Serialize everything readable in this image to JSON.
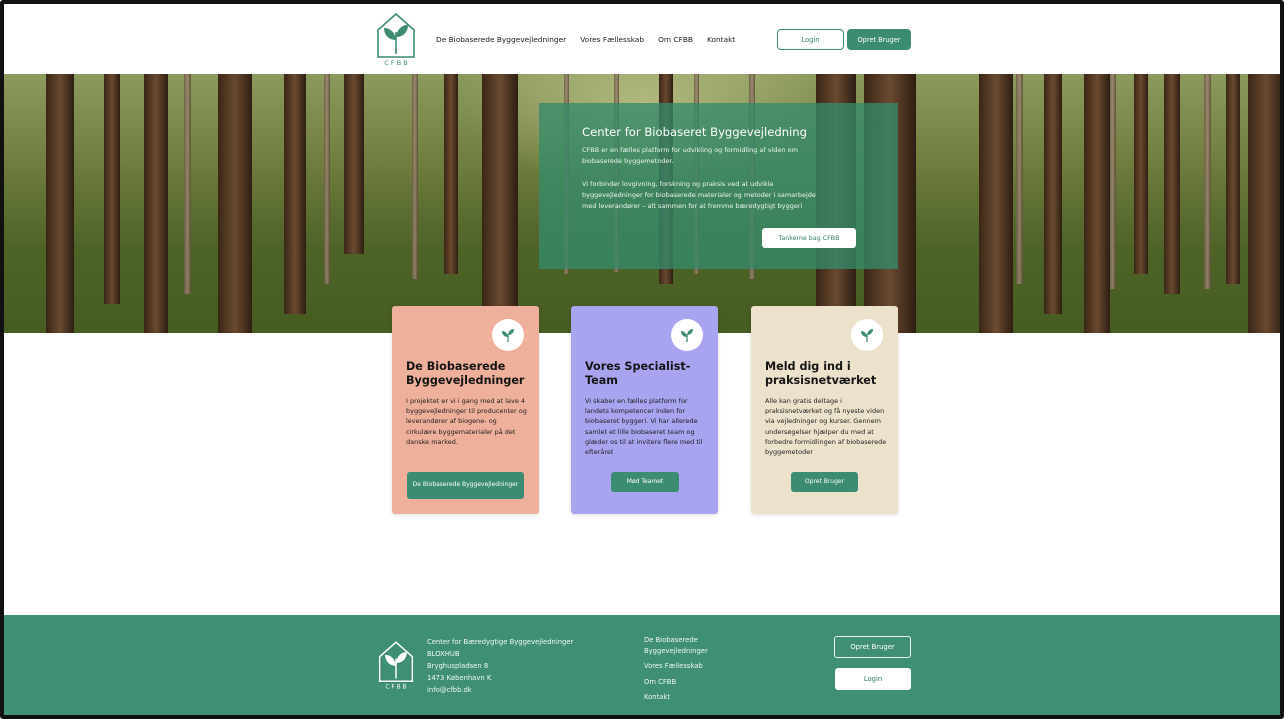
{
  "brand": {
    "logo_text": "C F B B",
    "accent": "#3b8c73",
    "footer_bg": "#3e8f76"
  },
  "header": {
    "nav": [
      "De Biobaserede Byggevejledninger",
      "Vores Fællesskab",
      "Om CFBB",
      "Kontakt"
    ],
    "login_label": "Login",
    "signup_label": "Opret Bruger"
  },
  "hero": {
    "title": "Center for Biobaseret Byggevejledning",
    "paragraph1": "CFBB er en fælles platform for udvikling og formidling af viden om biobaserede byggemetoder.",
    "paragraph2": "Vi forbinder lovgivning, forskning og praksis ved at udvikle byggevejledninger for biobaserede materialer og metoder i samarbejde med leverandører – alt sammen for at fremme bæredygtigt byggeri",
    "button_label": "Tankerne bag CFBB"
  },
  "cards": [
    {
      "title": "De Biobaserede Byggevejledninger",
      "text": "I projektet er vi i gang med at lave 4 byggevejledninger til producenter og leverandører af biogene- og cirkulære byggematerialer på det danske marked.",
      "button_label": "De Biobaserede Byggevejledninger",
      "color": "#eeb09b",
      "icon": "sprout-icon"
    },
    {
      "title": "Vores Specialist-Team",
      "text": "Vi skaber en fælles platform for landets kompetencer inden for biobaseret byggeri. Vi har allerede samlet et lille biobaseret team og glæder os til at invitere flere med til efteråret",
      "button_label": "Mød Teamet",
      "color": "#a8a4ef",
      "icon": "sprout-icon"
    },
    {
      "title": "Meld dig ind i praksisnetværket",
      "text": "Alle kan gratis deltage i praksisnetværket og få nyeste viden via vejledninger og kurser. Gennem undersøgelser hjælper du med at forbedre formidlingen af biobaserede byggemetoder",
      "button_label": "Opret Bruger",
      "color": "#ece2cc",
      "icon": "sprout-icon"
    }
  ],
  "footer": {
    "address": [
      "Center for Bæredygtige Byggevejledninger",
      "BLOXHUB",
      "Bryghuspladsen 8",
      "1473 København K",
      "info@cfbb.dk"
    ],
    "links": [
      "De Biobaserede Byggevejledninger",
      "Vores Fællesskab",
      "Om CFBB",
      "Kontakt"
    ],
    "signup_label": "Opret Bruger",
    "login_label": "Login"
  }
}
